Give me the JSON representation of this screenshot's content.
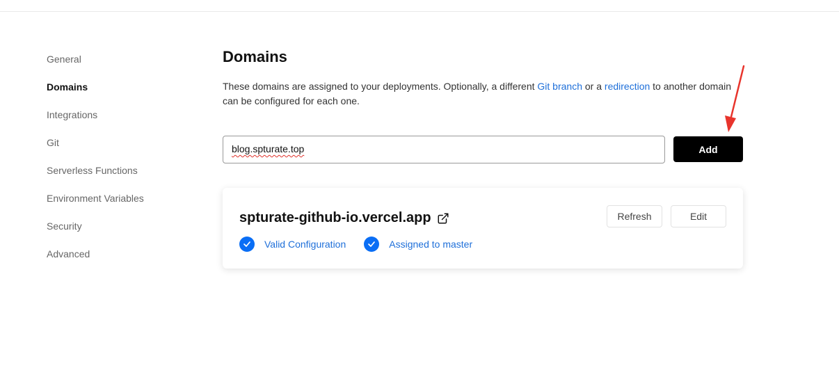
{
  "sidebar": {
    "items": [
      {
        "label": "General",
        "active": false
      },
      {
        "label": "Domains",
        "active": true
      },
      {
        "label": "Integrations",
        "active": false
      },
      {
        "label": "Git",
        "active": false
      },
      {
        "label": "Serverless Functions",
        "active": false
      },
      {
        "label": "Environment Variables",
        "active": false
      },
      {
        "label": "Security",
        "active": false
      },
      {
        "label": "Advanced",
        "active": false
      }
    ]
  },
  "main": {
    "title": "Domains",
    "description": {
      "part1": "These domains are assigned to your deployments. Optionally, a different ",
      "link1": "Git branch",
      "part2": " or a ",
      "link2": "redirection",
      "part3": " to another domain can be configured for each one."
    },
    "add_form": {
      "input_value": "blog.spturate.top",
      "add_label": "Add"
    },
    "domain_card": {
      "domain": "spturate-github-io.vercel.app",
      "refresh_label": "Refresh",
      "edit_label": "Edit",
      "statuses": [
        {
          "label": "Valid Configuration"
        },
        {
          "label": "Assigned to master"
        }
      ]
    }
  },
  "colors": {
    "accent": "#0a6ef5",
    "link": "#1e6fd9",
    "annotation_arrow": "#e8342c"
  },
  "icons": {
    "external_link": "external-link-icon",
    "check": "check-circle-icon",
    "arrow": "annotation-arrow-icon"
  }
}
